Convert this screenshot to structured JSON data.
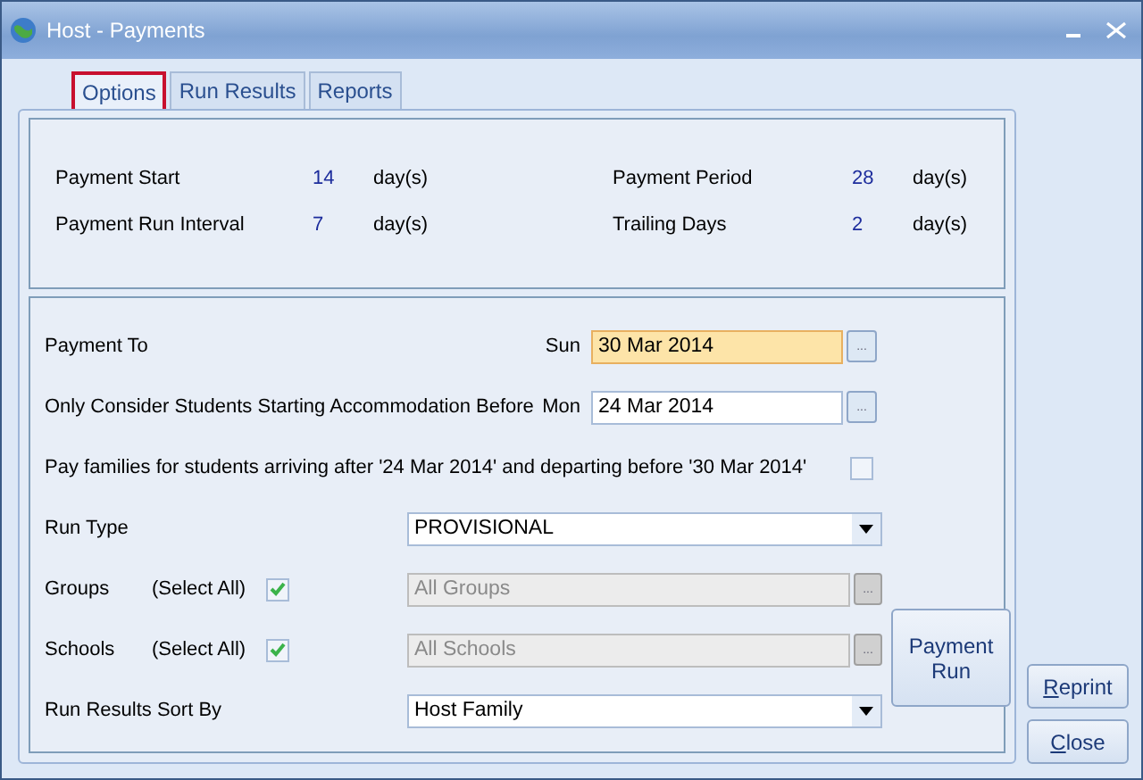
{
  "window": {
    "title": "Host - Payments"
  },
  "tabs": [
    {
      "label": "Options",
      "selected": true
    },
    {
      "label": "Run Results",
      "selected": false
    },
    {
      "label": "Reports",
      "selected": false
    }
  ],
  "summary": [
    {
      "label": "Payment Start",
      "value": "14",
      "unit": "day(s)"
    },
    {
      "label": "Payment Period",
      "value": "28",
      "unit": "day(s)"
    },
    {
      "label": "Payment Run Interval",
      "value": "7",
      "unit": "day(s)"
    },
    {
      "label": "Trailing Days",
      "value": "2",
      "unit": "day(s)"
    }
  ],
  "payment_to": {
    "label": "Payment To",
    "day": "Sun",
    "value": "30 Mar 2014",
    "focused": true,
    "button": "..."
  },
  "consider_before": {
    "label": "Only Consider Students Starting Accommodation Before",
    "day": "Mon",
    "value": "24 Mar 2014",
    "focused": false,
    "button": "..."
  },
  "pay_families": {
    "label": "Pay families for students arriving after '24 Mar 2014' and departing before '30 Mar 2014'",
    "checked": false
  },
  "run_type": {
    "label": "Run Type",
    "value": "PROVISIONAL"
  },
  "groups": {
    "label": "Groups",
    "select_all": "(Select All)",
    "checked": true,
    "value": "All Groups",
    "disabled": true,
    "button": "..."
  },
  "schools": {
    "label": "Schools",
    "select_all": "(Select All)",
    "checked": true,
    "value": "All Schools",
    "disabled": true,
    "button": "..."
  },
  "sort_by": {
    "label": "Run Results Sort By",
    "value": "Host Family"
  },
  "payment_run_button": "Payment Run",
  "side_buttons": [
    "Reprint",
    "Close"
  ]
}
